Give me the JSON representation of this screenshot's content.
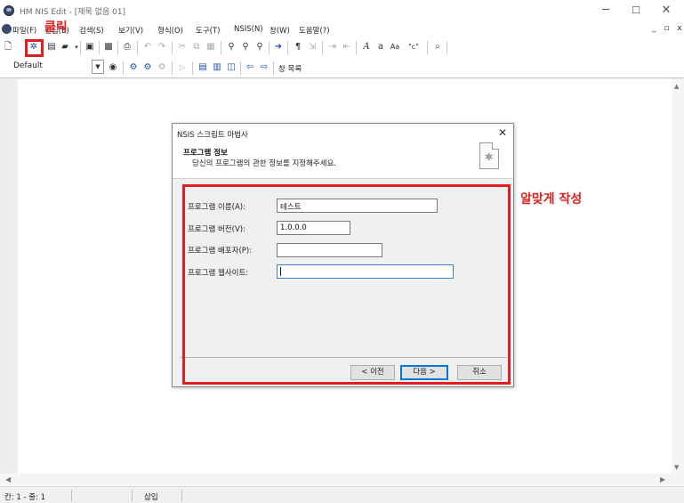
{
  "window": {
    "title": "HM NIS Edit - [제목 없음 01]",
    "min_glyph": "─",
    "max_glyph": "☐",
    "close_glyph": "✕"
  },
  "menu": {
    "items": [
      "파일(F)",
      "편집(E)",
      "검색(S)",
      "보기(V)",
      "형식(O)",
      "도구(T)",
      "NSIS(N)",
      "창(W)",
      "도움말(?)"
    ],
    "mdi_controls": "_ ▫ x"
  },
  "toolbar": {
    "combo_value": "Default",
    "script_list_label": "창 목록",
    "icons": {
      "new": "new-file-icon",
      "wizard": "script-wizard-icon",
      "templates": "template-icon",
      "open": "open-folder-icon",
      "save": "save-icon",
      "save_all": "save-all-icon",
      "print": "print-icon",
      "undo": "undo-icon",
      "redo": "redo-icon",
      "cut": "cut-icon",
      "copy": "copy-icon",
      "paste": "paste-icon",
      "find": "find-icon",
      "find_next": "find-next-icon",
      "replace": "replace-icon",
      "goto": "goto-icon",
      "paragraph": "paragraph-icon",
      "indent": "indent-icon",
      "outdent": "outdent-icon",
      "italic": "italic-font-icon",
      "lower": "lowercase-icon",
      "case": "case-icon",
      "quote": "quote-icon",
      "wrap": "wrap-icon"
    }
  },
  "status": {
    "position": "칸: 1 - 줄: 1",
    "mode": "삽입"
  },
  "dialog": {
    "title": "NSIS 스크립트 마법사",
    "close_glyph": "✕",
    "heading": "프로그램 정보",
    "subheading": "당신의 프로그램의 관한 정보를 지정해주세요.",
    "fields": [
      {
        "label": "프로그램 이름(A):",
        "value": "테스트"
      },
      {
        "label": "프로그램 버전(V):",
        "value": "1.0.0.0"
      },
      {
        "label": "프로그램 배포자(P):",
        "value": ""
      },
      {
        "label": "프로그램 웹사이트:",
        "value": ""
      }
    ],
    "buttons": {
      "back": "< 이전",
      "next": "다음 >",
      "cancel": "취소"
    }
  },
  "annotations": {
    "click_label": "클릭",
    "write_label": "알맞게 작성",
    "color": "#e02020"
  }
}
